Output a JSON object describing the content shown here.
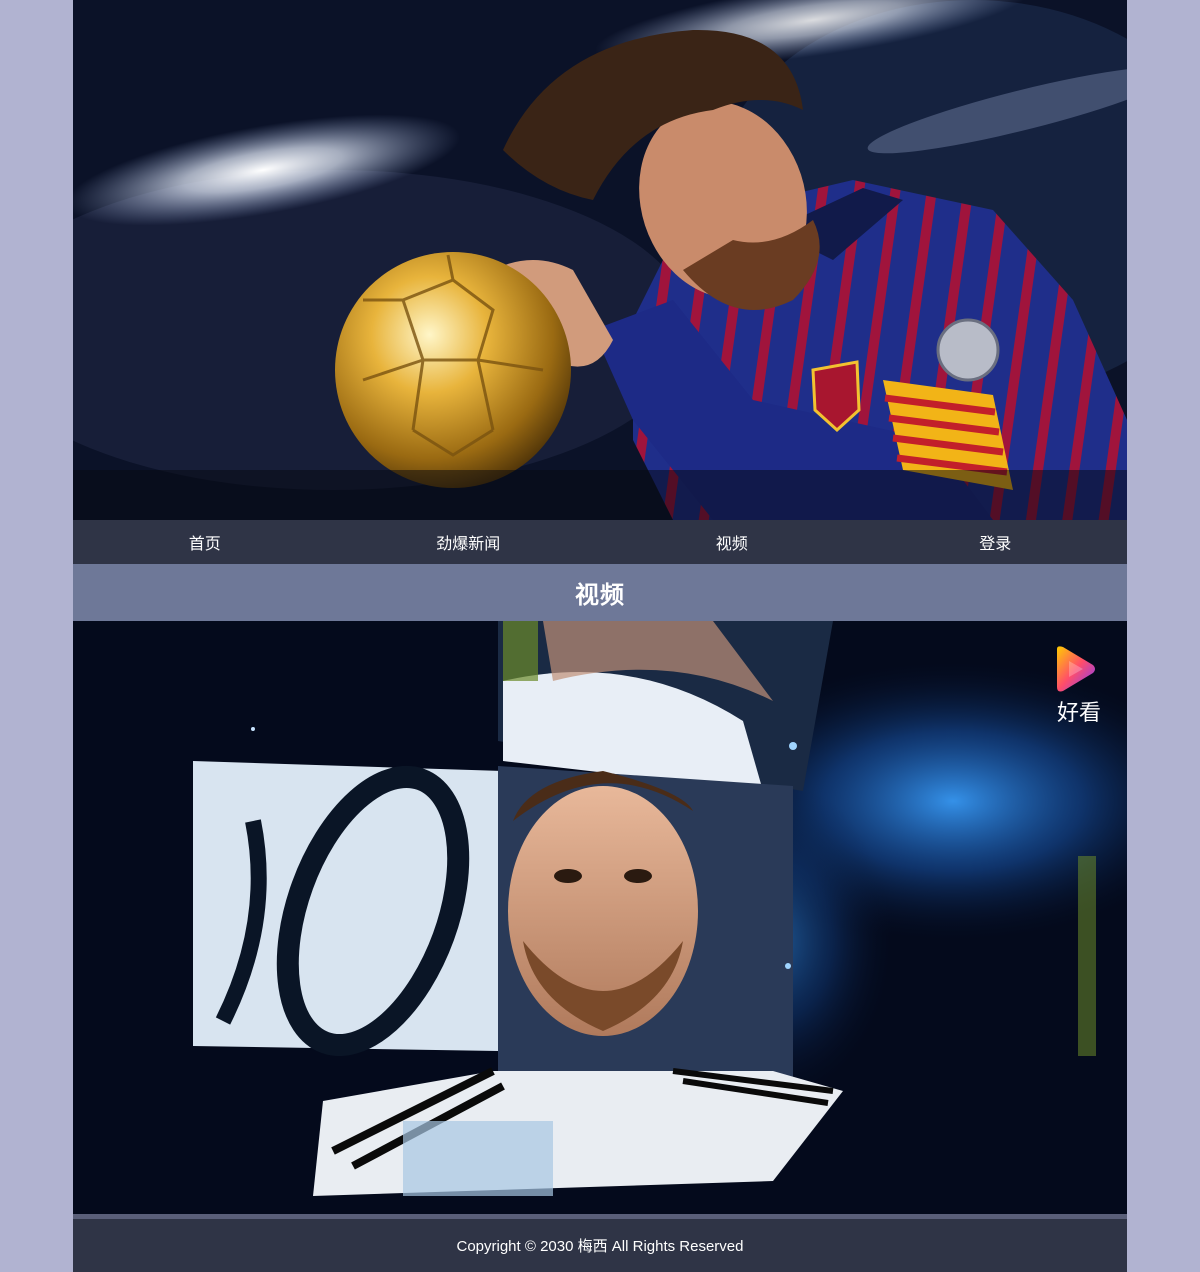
{
  "nav": {
    "items": [
      "首页",
      "劲爆新闻",
      "视频",
      "登录"
    ]
  },
  "section": {
    "title": "视频"
  },
  "video": {
    "watermark": "好看"
  },
  "footer": {
    "copyright": "Copyright © 2030 梅西 All Rights Reserved"
  },
  "colors": {
    "page_background": "#b1b3d1",
    "nav_background": "#2f3446",
    "section_header_background": "#6e7898",
    "footer_background": "#2f3446"
  },
  "icons": {
    "watermark_logo": "play-triangle-icon"
  }
}
